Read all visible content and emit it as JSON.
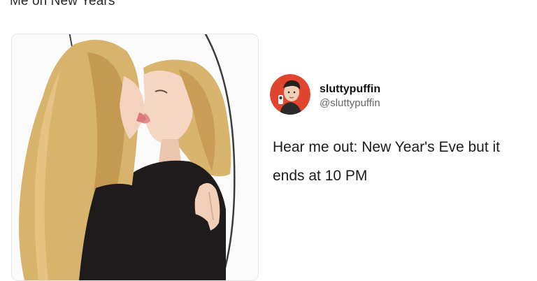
{
  "caption": "Me on New Years",
  "tweet": {
    "display_name": "sluttypuffin",
    "handle": "@sluttypuffin",
    "text": "Hear me out: New Year's Eve but it ends at 10 PM"
  },
  "colors": {
    "hair": "#d7b16a",
    "skin": "#f3d3c0",
    "clothing": "#1f1b1c",
    "avatar_bg": "#e2452f"
  },
  "icons": {
    "avatar": "cartoon-person-avatar",
    "image": "woman-kissing-mirror-illustration"
  }
}
